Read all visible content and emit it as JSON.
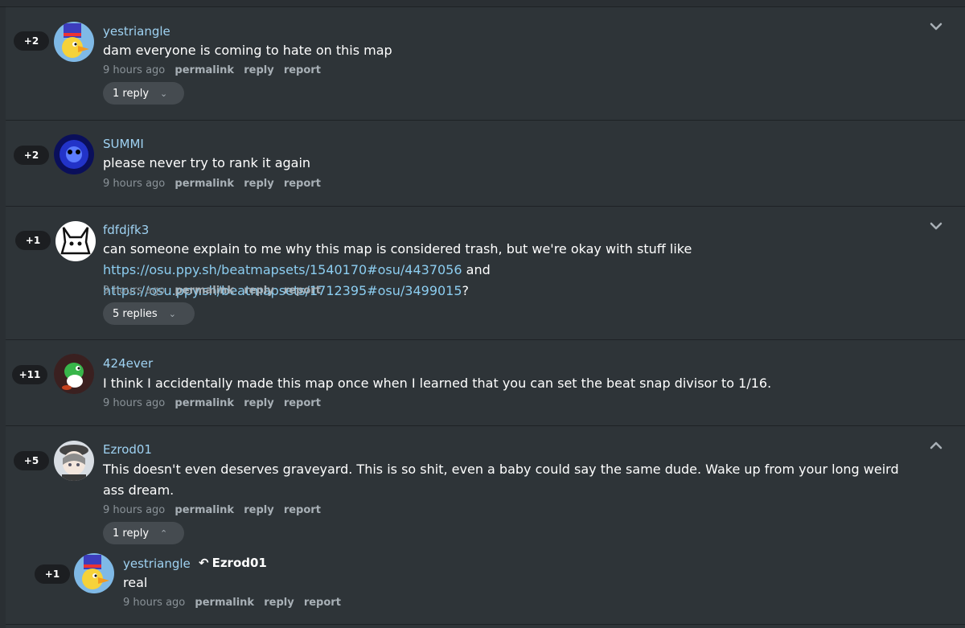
{
  "comments": [
    {
      "votes": "+2",
      "username": "yestriangle",
      "text": "dam everyone is coming to hate on this map",
      "time": "9 hours ago",
      "permalink": "permalink",
      "reply": "reply",
      "report": "report",
      "replies_label": "1 reply"
    },
    {
      "votes": "+2",
      "username": "SUMMI",
      "text": "please never try to rank it again",
      "time": "9 hours ago",
      "permalink": "permalink",
      "reply": "reply",
      "report": "report"
    },
    {
      "votes": "+1",
      "username": "fdfdjfk3",
      "text_before": "can someone explain to me why this map is considered trash, but we're okay with stuff like ",
      "link1": "https://osu.ppy.sh/beatmapsets/1540170#osu/4437056",
      "text_mid": " and ",
      "link2": "https://osu.ppy.sh/beatmapsets/1712395#osu/3499015",
      "text_after": "?",
      "time": "9 hours ago",
      "permalink": "permalink",
      "reply": "reply",
      "report": "report",
      "replies_label": "5 replies"
    },
    {
      "votes": "+11",
      "username": "424ever",
      "text": "I think I accidentally made this map once when I learned that you can set the beat snap divisor to 1/16.",
      "time": "9 hours ago",
      "permalink": "permalink",
      "reply": "reply",
      "report": "report"
    },
    {
      "votes": "+5",
      "username": "Ezrod01",
      "text": "This doesn't even deserves graveyard. This is so shit, even a baby could say the same dude. Wake up from your long weird ass dream.",
      "time": "9 hours ago",
      "permalink": "permalink",
      "reply": "reply",
      "report": "report",
      "replies_label": "1 reply"
    }
  ],
  "nested_reply": {
    "votes": "+1",
    "username": "yestriangle",
    "reply_to": "Ezrod01",
    "text": "real",
    "time": "9 hours ago",
    "permalink": "permalink",
    "reply": "reply",
    "report": "report"
  },
  "colors": {
    "background": "#2e3438",
    "username": "#9fd2f2",
    "link": "#8ccdf0",
    "vote_pill": "#1c1e21",
    "meta": "#8a9298"
  }
}
